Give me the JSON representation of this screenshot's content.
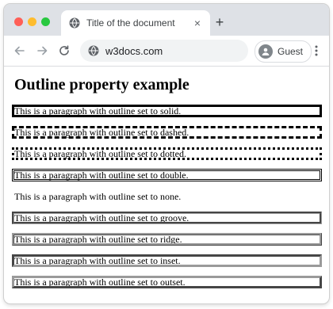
{
  "browser": {
    "tab_title": "Title of the document",
    "tab_close": "×",
    "new_tab": "+",
    "url": "w3docs.com",
    "profile_label": "Guest",
    "icons": {
      "back": "arrow-left",
      "forward": "arrow-right",
      "reload": "reload",
      "menu": "kebab-vertical",
      "favicon": "globe",
      "site_info": "globe"
    }
  },
  "page": {
    "heading": "Outline property example",
    "paragraphs": [
      {
        "style": "solid",
        "text": "This is a paragraph with outline set to solid."
      },
      {
        "style": "dashed",
        "text": "This is a paragraph with outline set to dashed."
      },
      {
        "style": "dotted",
        "text": "This is a paragraph with outline set to dotted."
      },
      {
        "style": "double",
        "text": "This is a paragraph with outline set to double."
      },
      {
        "style": "none",
        "text": "This is a paragraph with outline set to none."
      },
      {
        "style": "groove",
        "text": "This is a paragraph with outline set to groove."
      },
      {
        "style": "ridge",
        "text": "This is a paragraph with outline set to ridge."
      },
      {
        "style": "inset",
        "text": "This is a paragraph with outline set to inset."
      },
      {
        "style": "outset",
        "text": "This is a paragraph with outline set to outset."
      }
    ]
  },
  "colors": {
    "close": "#ff5f57",
    "minimize": "#febc2e",
    "zoom": "#28c840",
    "tabstrip": "#dee1e6",
    "omnibox": "#f1f3f4"
  }
}
